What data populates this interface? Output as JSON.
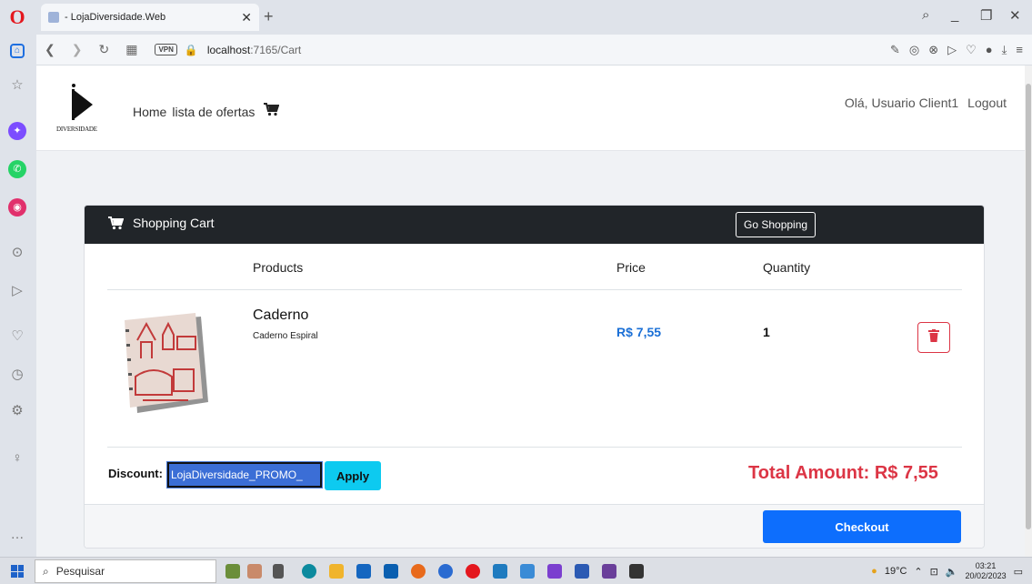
{
  "browser": {
    "tab_title": "- LojaDiversidade.Web",
    "url_host": "localhost",
    "url_rest": ":7165/Cart",
    "vpn_label": "VPN"
  },
  "site": {
    "logo_text": "DIVERSIDADE",
    "nav": {
      "home": "Home",
      "offers": "lista de ofertas"
    },
    "greeting": "Olá, Usuario Client1",
    "logout": "Logout"
  },
  "cart": {
    "header_title": "Shopping Cart",
    "go_shopping": "Go Shopping",
    "columns": {
      "products": "Products",
      "price": "Price",
      "quantity": "Quantity"
    },
    "items": [
      {
        "name": "Caderno",
        "description": "Caderno Espiral",
        "price": "R$ 7,55",
        "quantity": "1"
      }
    ],
    "discount_label": "Discount:",
    "discount_value": "LojaDiversidade_PROMO_",
    "apply_label": "Apply",
    "total_label": "Total Amount: R$ 7,55",
    "checkout_label": "Checkout"
  },
  "taskbar": {
    "search_placeholder": "Pesquisar",
    "weather": "19°C",
    "time": "03:21",
    "date": "20/02/2023"
  },
  "colors": {
    "accent_blue": "#0d6efd",
    "danger_red": "#dc3545",
    "info_cyan": "#0dcaf0",
    "header_dark": "#212529"
  }
}
